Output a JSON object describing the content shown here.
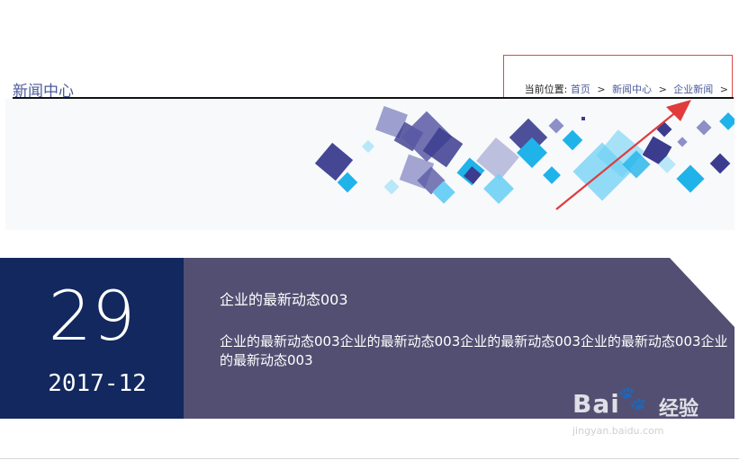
{
  "section": {
    "title": "新闻中心"
  },
  "breadcrumb": {
    "prefix": "当前位置:",
    "items": [
      {
        "label": "首页"
      },
      {
        "label": "新闻中心"
      },
      {
        "label": "企业新闻"
      }
    ],
    "separator": ">"
  },
  "banner": {
    "palette": [
      "#3b3c8e",
      "#5a5aa6",
      "#1fb3ea",
      "#6fd0f5",
      "#8d8fc7",
      "#b8e7f8"
    ]
  },
  "annotation": {
    "color": "#e23b3b"
  },
  "news": {
    "date_day": "29",
    "date_ym": "2017-12",
    "title": "企业的最新动态003",
    "summary": "企业的最新动态003企业的最新动态003企业的最新动态003企业的最新动态003企业的最新动态003"
  },
  "watermark": {
    "brand": "Bai",
    "brand_cn": "经验",
    "url": "jingyan.baidu.com"
  }
}
